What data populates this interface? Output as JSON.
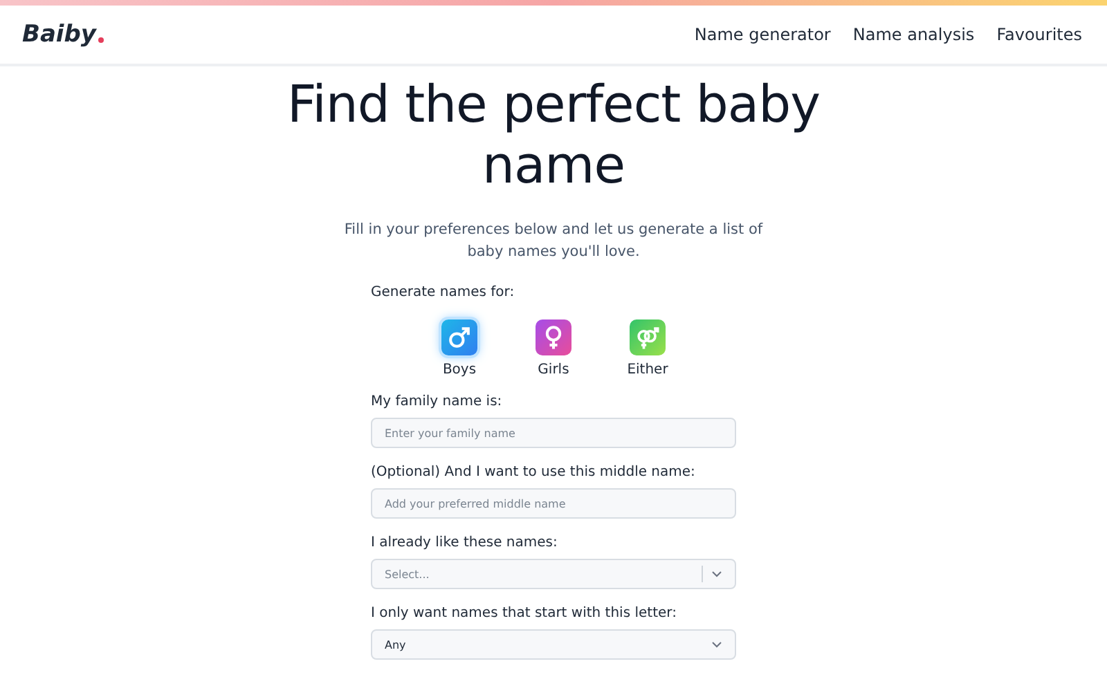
{
  "logo": "Baiby",
  "nav": [
    {
      "label": "Name generator"
    },
    {
      "label": "Name analysis"
    },
    {
      "label": "Favourites"
    }
  ],
  "title": "Find the perfect baby name",
  "subtitle": "Fill in your preferences below and let us generate a list of baby names you'll love.",
  "gender_label": "Generate names for:",
  "genders": [
    {
      "kind": "male",
      "label": "Boys",
      "selected": true
    },
    {
      "kind": "female",
      "label": "Girls",
      "selected": false
    },
    {
      "kind": "either",
      "label": "Either",
      "selected": false
    }
  ],
  "fields": [
    {
      "kind": "text",
      "label": "My family name is:",
      "placeholder": "Enter your family name"
    },
    {
      "kind": "text",
      "label": "(Optional) And I want to use this middle name:",
      "placeholder": "Add your preferred middle name"
    },
    {
      "kind": "multiselect",
      "label": "I already like these names:",
      "placeholder": "Select..."
    },
    {
      "kind": "select",
      "label": "I only want names that start with this letter:",
      "value": "Any"
    }
  ]
}
